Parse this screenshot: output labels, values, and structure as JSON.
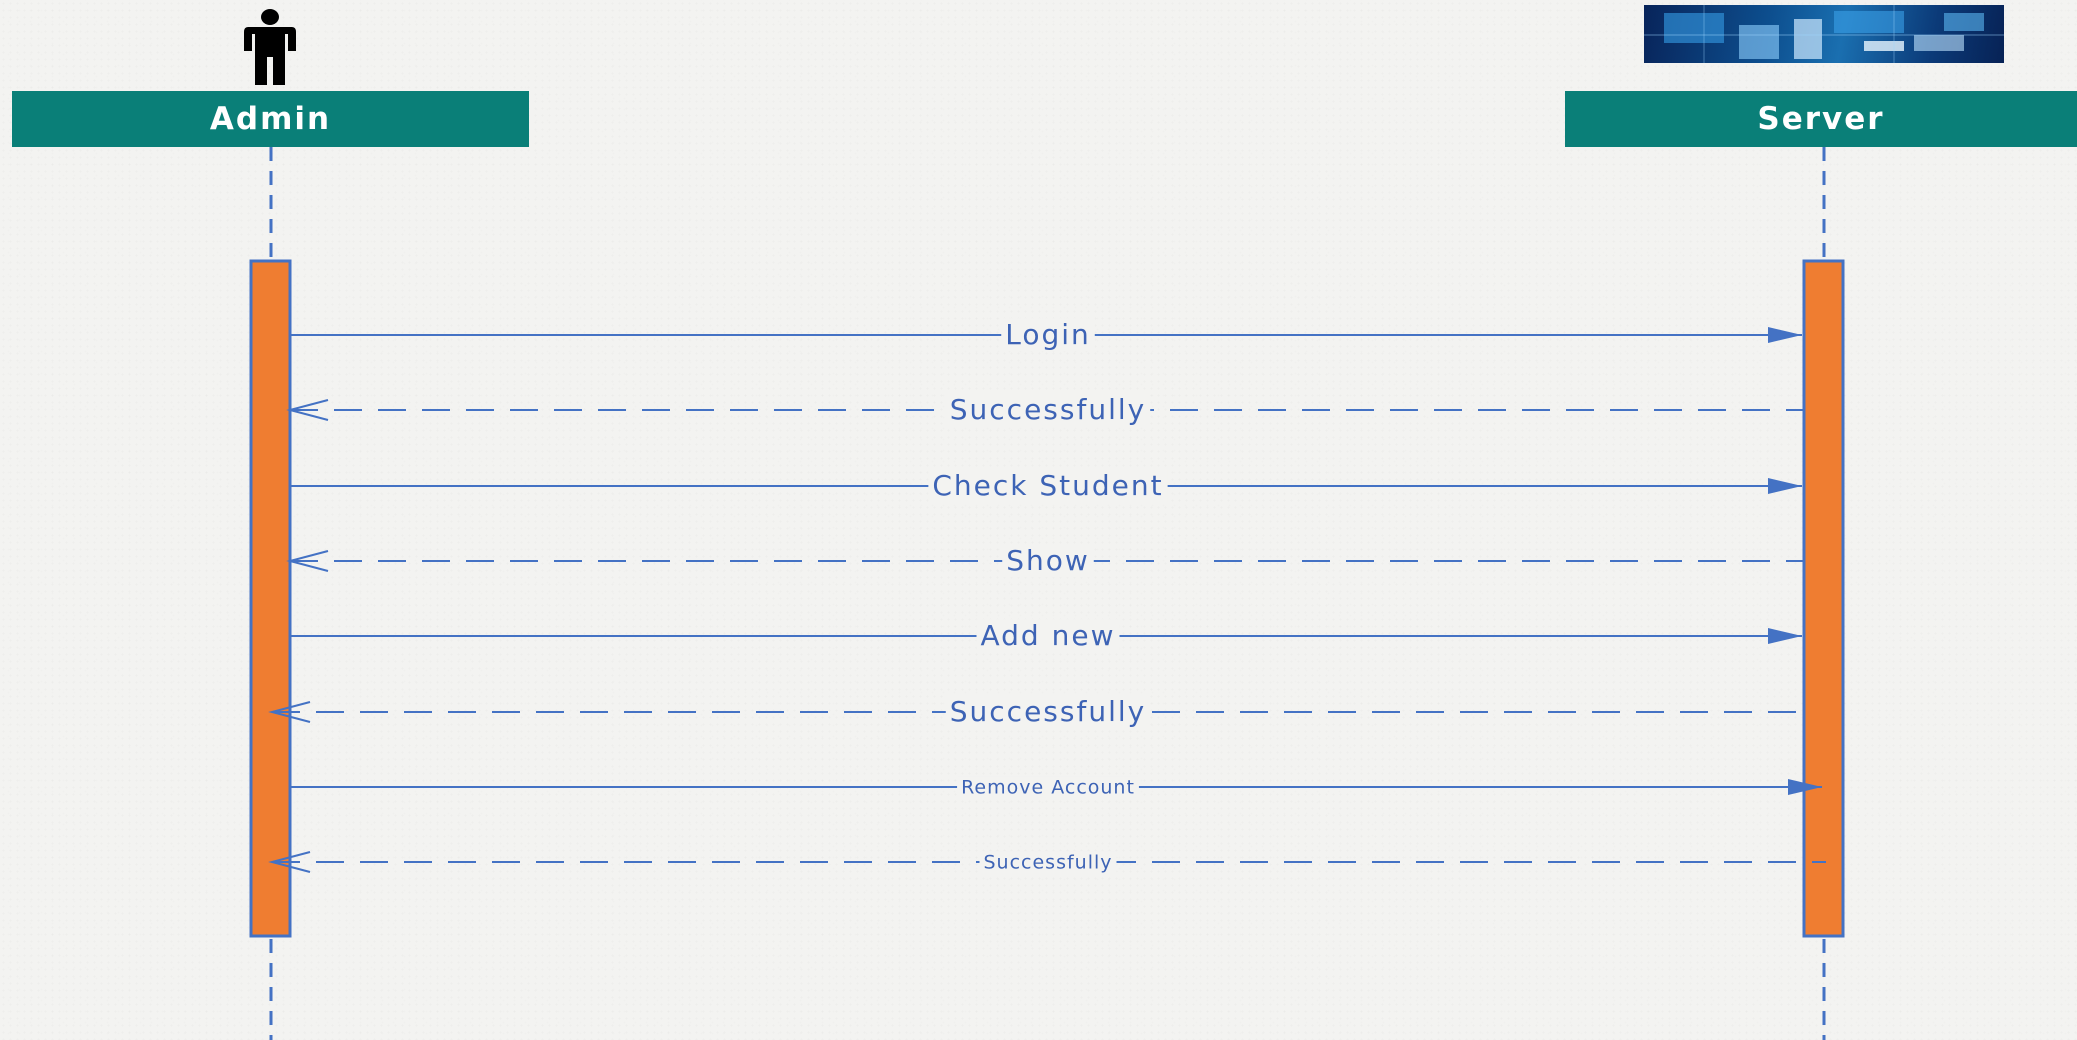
{
  "participants": [
    {
      "name": "Admin",
      "icon": "person-actor-icon"
    },
    {
      "name": "Server",
      "icon": "server-network-image"
    }
  ],
  "messages": [
    {
      "label": "Login",
      "direction": "admin-to-server",
      "style": "solid"
    },
    {
      "label": "Successfully",
      "direction": "server-to-admin",
      "style": "dashed"
    },
    {
      "label": "Check Student",
      "direction": "admin-to-server",
      "style": "solid"
    },
    {
      "label": "Show",
      "direction": "server-to-admin",
      "style": "dashed"
    },
    {
      "label": "Add new",
      "direction": "admin-to-server",
      "style": "solid"
    },
    {
      "label": "Successfully",
      "direction": "server-to-admin",
      "style": "dashed"
    },
    {
      "label": "Remove Account",
      "direction": "admin-to-server",
      "style": "solid"
    },
    {
      "label": "Successfully",
      "direction": "server-to-admin",
      "style": "dashed"
    }
  ],
  "colors": {
    "header": "#0a7f78",
    "header_text": "#ffffff",
    "activation": "#ef7d31",
    "line": "#4472c4",
    "label": "#3d63b5"
  }
}
